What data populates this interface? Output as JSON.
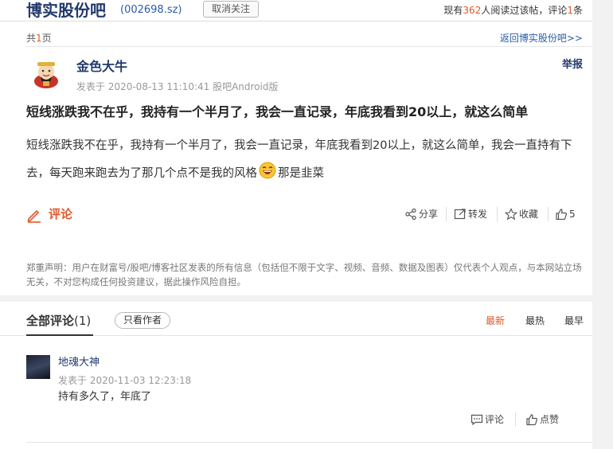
{
  "header": {
    "bar_name": "博实股份吧",
    "stock_code": "(002698.sz)",
    "unfollow_label": "取消关注",
    "read_prefix": "现有",
    "read_count": "362",
    "read_mid": "人阅读过该帖，评论",
    "comment_count": "1",
    "read_suffix": "条"
  },
  "page_info": {
    "total_prefix": "共",
    "total_pages": "1",
    "total_suffix": "页",
    "back_link": "返回博实股份吧>>"
  },
  "post": {
    "author": "金色大牛",
    "report_label": "举报",
    "posted_time": "发表于 2020-08-13 11:10:41 股吧Android版",
    "title": "短线涨跌我不在乎，我持有一个半月了，我会一直记录，年底我看到20以上，就这么简单",
    "body_part1": "短线涨跌我不在乎，我持有一个半月了，我会一直记录，年底我看到20以上，就这么简单，我会一直持有下去，每天跑来跑去为了那几个点不是我的风格",
    "body_part2": "那是韭菜",
    "comment_label": "评论",
    "actions": {
      "share": "分享",
      "repost": "转发",
      "collect": "收藏",
      "likes": "5"
    },
    "disclaimer": "郑重声明：用户在财富号/股吧/博客社区发表的所有信息（包括但不限于文字、视频、音频、数据及图表）仅代表个人观点，与本网站立场无关，不对您构成任何投资建议，据此操作风险自担。"
  },
  "comments": {
    "heading": "全部评论",
    "count": "(1)",
    "author_only_label": "只看作者",
    "sort": {
      "newest": "最新",
      "hottest": "最热",
      "oldest": "最早"
    },
    "items": [
      {
        "author": "地魂大神",
        "time": "发表于 2020-11-03 12:23:18",
        "text": "持有多久了，年底了",
        "comment_label": "评论",
        "like_label": "点赞"
      }
    ]
  },
  "colors": {
    "accent": "#e2572b",
    "link": "#2a5ca8",
    "title_blue": "#223a6e"
  }
}
